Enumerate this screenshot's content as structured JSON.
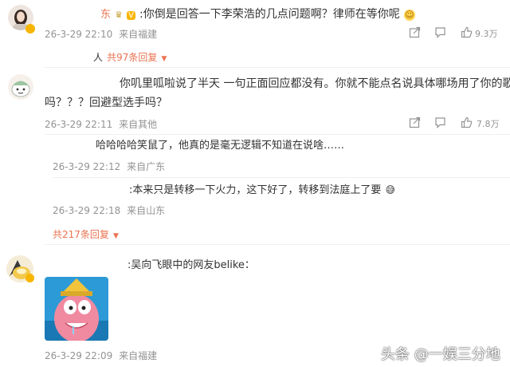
{
  "comments": [
    {
      "name_fragment": "东",
      "vip_badge": "V",
      "text": ":你倒是回答一下李荣浩的几点问题啊？律师在等你呢",
      "emoji": "☺",
      "time": "26-3-29 22:10",
      "source": "来自福建",
      "likes": "9.3万",
      "replies_name": "人",
      "replies_label": "共97条回复"
    },
    {
      "text_line1": "你叽里呱啦说了半天 一句正面回应都没有。你就不能点名说具体哪场用了你的歌",
      "text_line2": "吗？？？回避型选手吗？",
      "time": "26-3-29 22:11",
      "source": "来自其他",
      "likes": "7.8万"
    },
    {
      "text": "哈哈哈哈笑鼠了，他真的是毫无逻辑不知道在说啥……",
      "time": "26-3-29 22:12",
      "source": "来自广东"
    },
    {
      "text": ":本来只是转移一下火力，这下好了，转移到法庭上了要",
      "emoji": "😅",
      "time": "26-3-29 22:18",
      "source": "来自山东",
      "replies_label": "共217条回复"
    },
    {
      "text": ":吴向飞眼中的网友belike：",
      "time": "26-3-29 22:09",
      "source": "来自福建"
    }
  ],
  "watermark": "头条 @一娱三分地",
  "icons": {
    "share": "share-icon",
    "comment": "comment-icon",
    "like": "thumbs-up-icon",
    "dropdown": "chevron-down-icon"
  },
  "colors": {
    "accent": "#eb7350",
    "meta": "#939393",
    "text": "#333333"
  }
}
